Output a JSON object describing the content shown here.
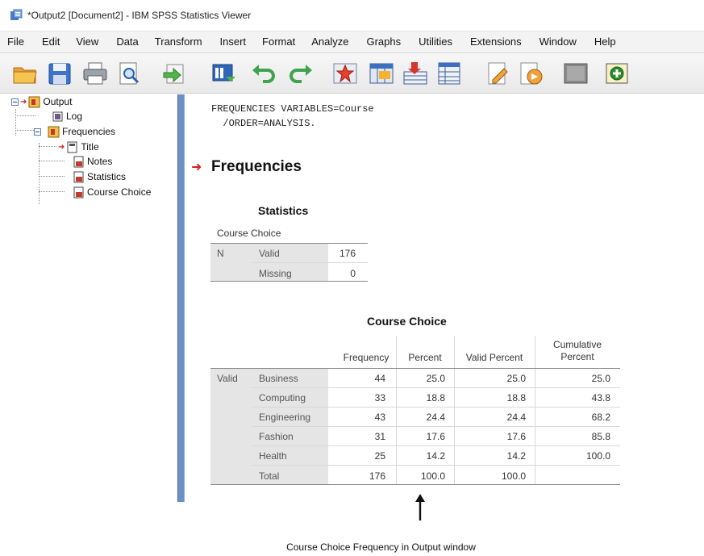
{
  "window": {
    "title": "*Output2 [Document2] - IBM SPSS Statistics Viewer"
  },
  "menu": [
    "File",
    "Edit",
    "View",
    "Data",
    "Transform",
    "Insert",
    "Format",
    "Analyze",
    "Graphs",
    "Utilities",
    "Extensions",
    "Window",
    "Help"
  ],
  "toolbar": {
    "icons": [
      "open-folder-icon",
      "save-icon",
      "print-icon",
      "print-preview-icon",
      "export-icon",
      "recall-dialog-icon",
      "undo-icon",
      "redo-icon",
      "goto-case-icon",
      "goto-variable-icon",
      "select-cases-icon",
      "variables-icon",
      "designate-window-icon",
      "promote-icon",
      "demote-icon",
      "insert-heading-icon",
      "show-all-icon"
    ]
  },
  "outline": {
    "root": "Output",
    "log": "Log",
    "frequencies": "Frequencies",
    "children": [
      "Title",
      "Notes",
      "Statistics",
      "Course Choice"
    ]
  },
  "syntax": {
    "line1": "FREQUENCIES VARIABLES=Course",
    "line2": "  /ORDER=ANALYSIS."
  },
  "output_heading": "Frequencies",
  "statistics_table": {
    "title": "Statistics",
    "subtitle": "Course Choice",
    "n_label": "N",
    "valid_label": "Valid",
    "valid_value": "176",
    "missing_label": "Missing",
    "missing_value": "0"
  },
  "course_table": {
    "title": "Course Choice",
    "headers": {
      "frequency": "Frequency",
      "percent": "Percent",
      "valid_percent": "Valid Percent",
      "cumulative_line1": "Cumulative",
      "cumulative_line2": "Percent"
    },
    "group_label": "Valid",
    "rows": [
      {
        "label": "Business",
        "frequency": "44",
        "percent": "25.0",
        "valid_percent": "25.0",
        "cumulative": "25.0"
      },
      {
        "label": "Computing",
        "frequency": "33",
        "percent": "18.8",
        "valid_percent": "18.8",
        "cumulative": "43.8"
      },
      {
        "label": "Engineering",
        "frequency": "43",
        "percent": "24.4",
        "valid_percent": "24.4",
        "cumulative": "68.2"
      },
      {
        "label": "Fashion",
        "frequency": "31",
        "percent": "17.6",
        "valid_percent": "17.6",
        "cumulative": "85.8"
      },
      {
        "label": "Health",
        "frequency": "25",
        "percent": "14.2",
        "valid_percent": "14.2",
        "cumulative": "100.0"
      },
      {
        "label": "Total",
        "frequency": "176",
        "percent": "100.0",
        "valid_percent": "100.0",
        "cumulative": ""
      }
    ]
  },
  "caption": "Course Choice Frequency in Output window",
  "colors": {
    "splitter": "#6b8fc7",
    "heading_arrow": "#d92020",
    "row_header_fill": "#e5e5e5"
  }
}
